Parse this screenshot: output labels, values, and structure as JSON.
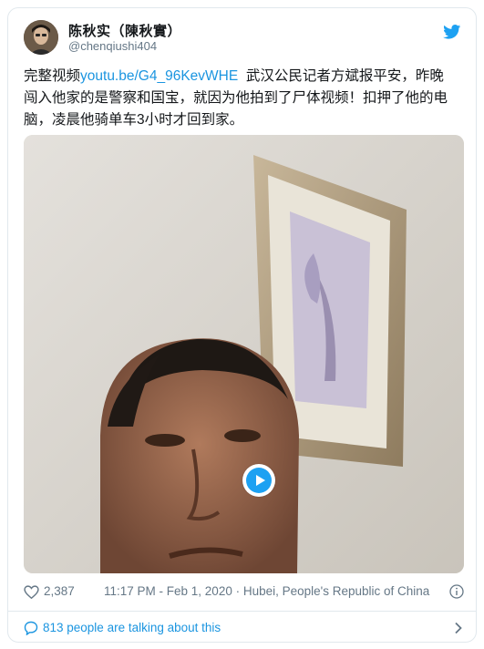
{
  "tweet": {
    "display_name": "陈秋实（陳秋實）",
    "handle": "@chenqiushi404",
    "text_prefix": "完整视频",
    "link": "youtu.be/G4_96KevWHE",
    "text_line1_rest": "  武汉公民记者方斌报平安，昨晚",
    "text_line2": "闯入他家的是警察和国宝，就因为他拍到了尸体视频！扣押了他的电",
    "text_line3": "脑，凌晨他骑单车3小时才回到家。"
  },
  "stats": {
    "likes": "2,387",
    "timestamp": "11:17 PM - Feb 1, 2020 · Hubei, People's Republic of China"
  },
  "footer": {
    "talking": "813 people are talking about this"
  },
  "colors": {
    "link": "#1b95e0",
    "accent": "#1da1f2",
    "secondary_text": "#657786",
    "border": "#e1e8ed"
  },
  "icons": [
    "twitter-bird-icon",
    "play-icon",
    "heart-icon",
    "info-icon",
    "speech-bubble-icon",
    "chevron-right-icon"
  ]
}
